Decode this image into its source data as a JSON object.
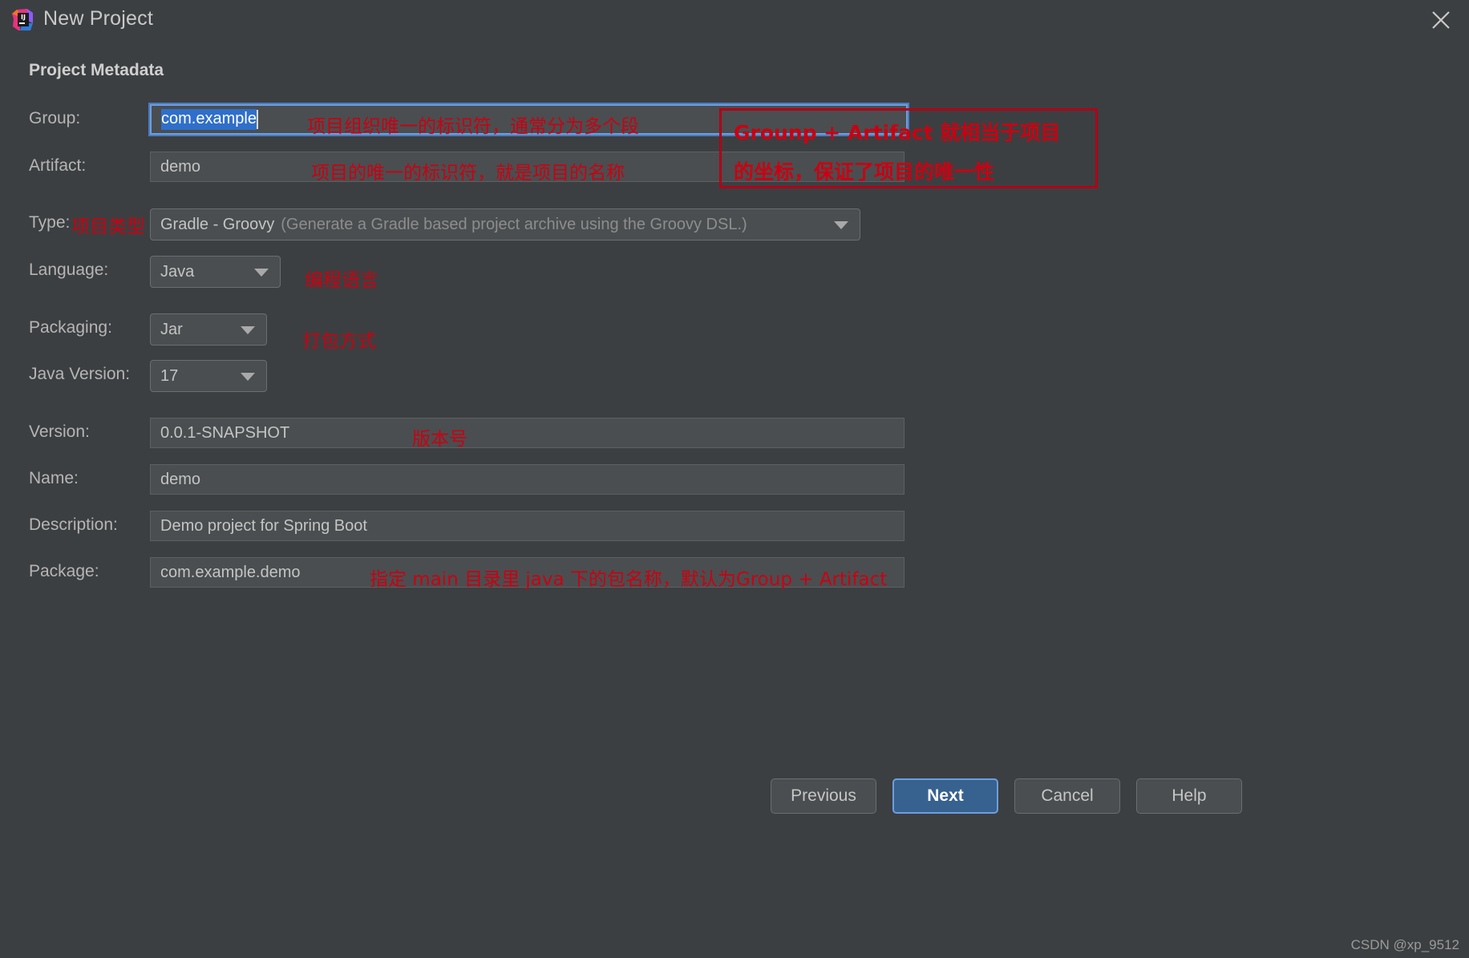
{
  "window": {
    "title": "New Project",
    "logo_icon": "intellij-idea-logo",
    "close_icon": "close-icon"
  },
  "section": {
    "title": "Project Metadata"
  },
  "fields": {
    "group": {
      "label": "Group:",
      "value": "com.example",
      "selected": true
    },
    "artifact": {
      "label": "Artifact:",
      "value": "demo"
    },
    "type": {
      "label": "Type:",
      "value": "Gradle - Groovy",
      "hint": "(Generate a Gradle based project archive using the Groovy DSL.)"
    },
    "language": {
      "label": "Language:",
      "value": "Java"
    },
    "packaging": {
      "label": "Packaging:",
      "value": "Jar"
    },
    "java_version": {
      "label": "Java Version:",
      "value": "17"
    },
    "version": {
      "label": "Version:",
      "value": "0.0.1-SNAPSHOT"
    },
    "name": {
      "label": "Name:",
      "value": "demo"
    },
    "description": {
      "label": "Description:",
      "value": "Demo project for Spring Boot"
    },
    "package": {
      "label": "Package:",
      "value": "com.example.demo"
    }
  },
  "annotations": {
    "group": "项目组织唯一的标识符，通常分为多个段",
    "artifact": "项目的唯一的标识符，就是项目的名称",
    "box_line1": "Grounp + Artifact 就相当于项目",
    "box_line2": "的坐标，保证了项目的唯一性",
    "type": "项目类型",
    "language": "编程语言",
    "packaging": "打包方式",
    "version": "版本号",
    "package": "指定 main 目录里 java 下的包名称，默认为Group + Artifact"
  },
  "buttons": {
    "previous": "Previous",
    "next": "Next",
    "cancel": "Cancel",
    "help": "Help"
  },
  "watermark": "CSDN @xp_9512",
  "colors": {
    "background": "#3c3f41",
    "annotation_red": "#cc0011",
    "box_red": "#b00018",
    "primary_button": "#37618f",
    "selection_blue": "#2f6fca",
    "focus_border": "#6d9ee0"
  }
}
